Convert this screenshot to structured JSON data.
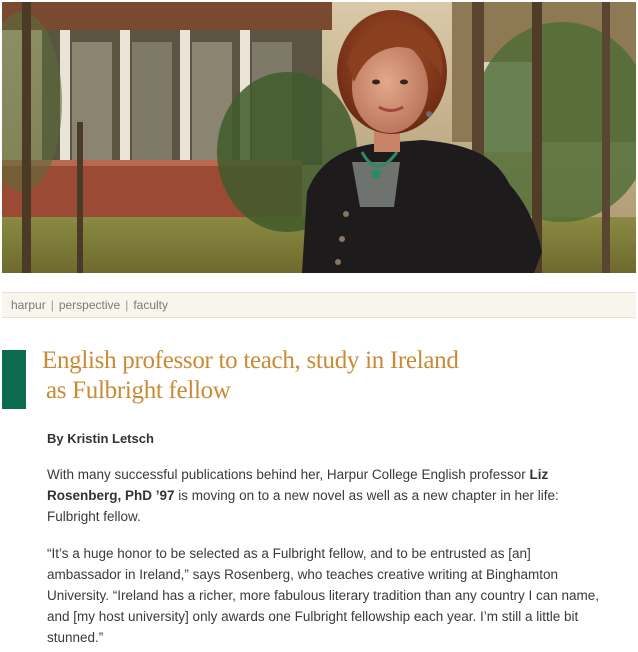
{
  "breadcrumb": {
    "items": [
      "harpur",
      "perspective",
      "faculty"
    ],
    "separator": "|"
  },
  "article": {
    "headline_line1": "English professor to teach, study in Ireland",
    "headline_line2": "as Fulbright fellow",
    "byline": "By Kristin Letsch",
    "para1": {
      "lead": "With many successful publications behind her, Harpur College English professor ",
      "name": "Liz Rosenberg, PhD ’97",
      "rest": " is moving on to a new novel as well as a new chapter in her life: Fulbright fellow."
    },
    "para2": "“It’s a huge honor to be selected as a Fulbright fellow, and to be entrusted as [an] ambassador in Ireland,” says Rosenberg, who teaches creative writing at Binghamton University. “Ireland has a richer, more fabulous literary tradition than any country I can name, and [my host university] only awards one Fulbright fellowship each year. I’m still a little bit stunned.”"
  },
  "colors": {
    "headline": "#c98a33",
    "accent_bar": "#0c6a4f",
    "breadcrumb_bg": "#f7f5ec",
    "breadcrumb_text": "#7b7b73"
  },
  "hero_image": {
    "subject": "portrait of professor outdoors in front of campus building"
  }
}
